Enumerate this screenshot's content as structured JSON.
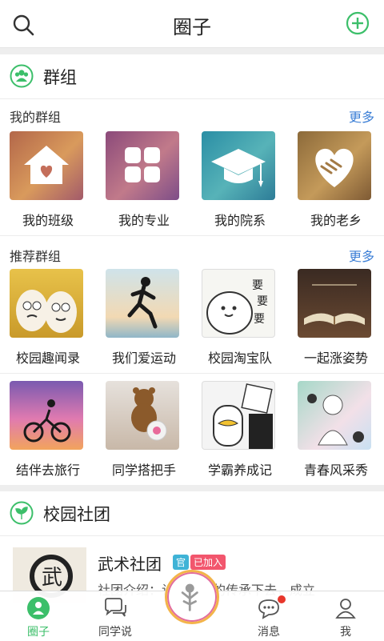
{
  "header": {
    "title": "圈子",
    "search_icon": "search-icon",
    "add_icon": "add-circle-icon"
  },
  "groups_section": {
    "title": "群组",
    "icon": "people-icon",
    "my_groups": {
      "label": "我的群组",
      "more": "更多",
      "items": [
        {
          "name": "我的班级",
          "icon": "house-heart-icon"
        },
        {
          "name": "我的专业",
          "icon": "grid-icon"
        },
        {
          "name": "我的院系",
          "icon": "graduation-cap-icon"
        },
        {
          "name": "我的老乡",
          "icon": "handshake-heart-icon"
        }
      ]
    },
    "recommended": {
      "label": "推荐群组",
      "more": "更多",
      "items": [
        {
          "name": "校园趣闻录"
        },
        {
          "name": "我们爱运动"
        },
        {
          "name": "校园淘宝队"
        },
        {
          "name": "一起涨姿势"
        },
        {
          "name": "结伴去旅行"
        },
        {
          "name": "同学搭把手"
        },
        {
          "name": "学霸养成记"
        },
        {
          "name": "青春风采秀"
        }
      ]
    }
  },
  "clubs_section": {
    "title": "校园社团",
    "icon": "leaf-icon",
    "items": [
      {
        "name": "武术社团",
        "badge_official": "官",
        "badge_joined": "已加入",
        "intro": "社团介绍：让武术好的传承下去，成立"
      }
    ]
  },
  "tabbar": {
    "tabs": [
      {
        "label": "圈子",
        "icon": "circle-people-icon",
        "active": true
      },
      {
        "label": "同学说",
        "icon": "chat-bubbles-icon",
        "active": false
      },
      {
        "label": "",
        "icon": "tree-person-icon",
        "active": false
      },
      {
        "label": "消息",
        "icon": "message-icon",
        "active": false,
        "badge": true
      },
      {
        "label": "我",
        "icon": "person-icon",
        "active": false
      }
    ]
  },
  "colors": {
    "accent": "#3cbf6a",
    "link": "#3c7fd6",
    "badge_official": "#3fb3d6",
    "badge_joined": "#f2566d"
  }
}
